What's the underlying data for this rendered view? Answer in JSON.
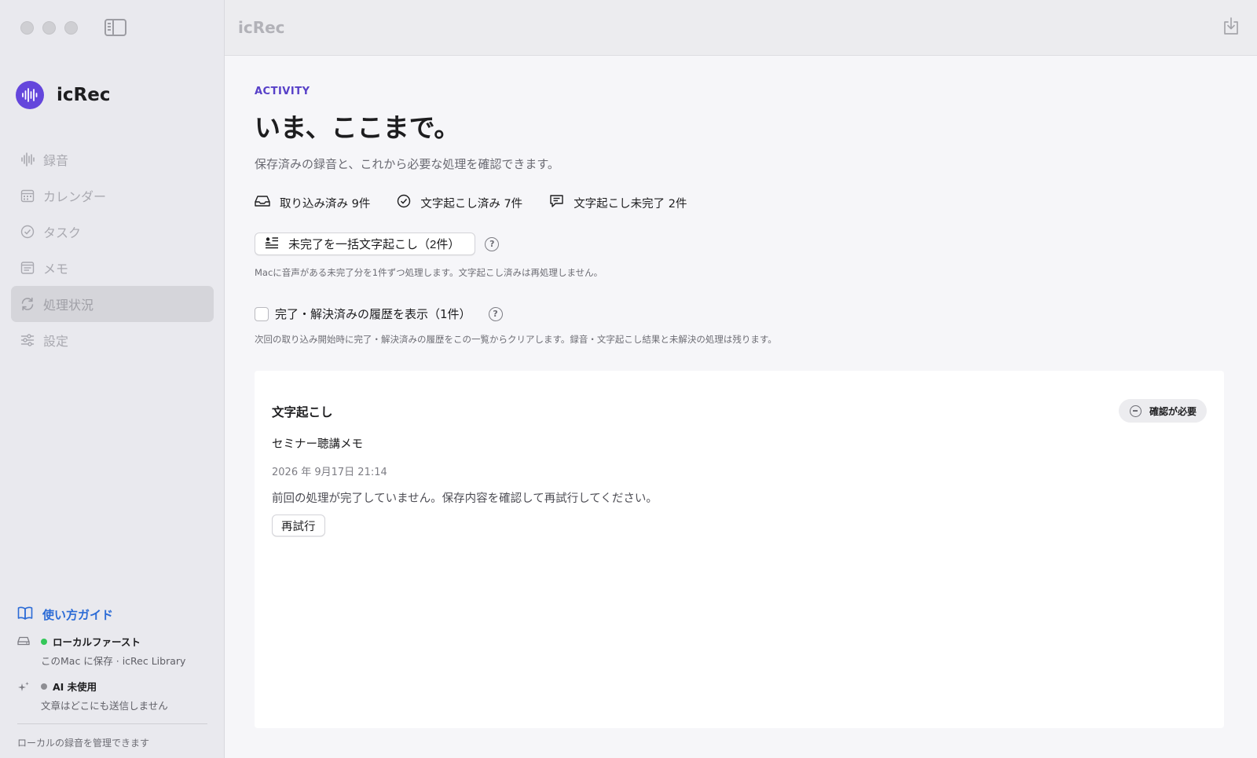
{
  "app": {
    "name": "icRec",
    "window_title": "icRec"
  },
  "sidebar": {
    "items": [
      {
        "label": "録音",
        "icon": "waveform-icon",
        "active": false
      },
      {
        "label": "カレンダー",
        "icon": "calendar-icon",
        "active": false
      },
      {
        "label": "タスク",
        "icon": "checkmark-circle-icon",
        "active": false
      },
      {
        "label": "メモ",
        "icon": "note-icon",
        "active": false
      },
      {
        "label": "処理状況",
        "icon": "sync-icon",
        "active": true
      },
      {
        "label": "設定",
        "icon": "sliders-icon",
        "active": false
      }
    ],
    "guide_label": "使い方ガイド",
    "local_first": {
      "title": "ローカルファースト",
      "sub": "このMac に保存 · icRec Library",
      "dot_color": "#34c759"
    },
    "ai": {
      "title": "AI 未使用",
      "sub": "文章はどこにも送信しません",
      "dot_color": "#8e8e93"
    },
    "footer_note": "ローカルの録音を管理できます"
  },
  "main": {
    "eyebrow": "ACTIVITY",
    "title": "いま、ここまで。",
    "subtitle": "保存済みの録音と、これから必要な処理を確認できます。",
    "stats": [
      {
        "icon": "tray-icon",
        "label": "取り込み済み 9件"
      },
      {
        "icon": "check-circle-icon",
        "label": "文字起こし済み 7件"
      },
      {
        "icon": "message-icon",
        "label": "文字起こし未完了 2件"
      }
    ],
    "batch_button": "未完了を一括文字起こし（2件）",
    "batch_note": "Macに音声がある未完了分を1件ずつ処理します。文字起こし済みは再処理しません。",
    "history_checkbox": "完了・解決済みの履歴を表示（1件）",
    "history_checked": false,
    "history_note": "次回の取り込み開始時に完了・解決済みの履歴をこの一覧からクリアします。録音・文字起こし結果と未解決の処理は残ります。",
    "card": {
      "title": "文字起こし",
      "badge": "確認が必要",
      "item_title": "セミナー聴講メモ",
      "item_date": "2026 年 9月17日 21:14",
      "message": "前回の処理が完了していません。保存内容を確認して再試行してください。",
      "retry": "再試行"
    }
  },
  "colors": {
    "accent": "#5740c8",
    "link": "#2b6bd6",
    "logo": "#6446dc"
  }
}
